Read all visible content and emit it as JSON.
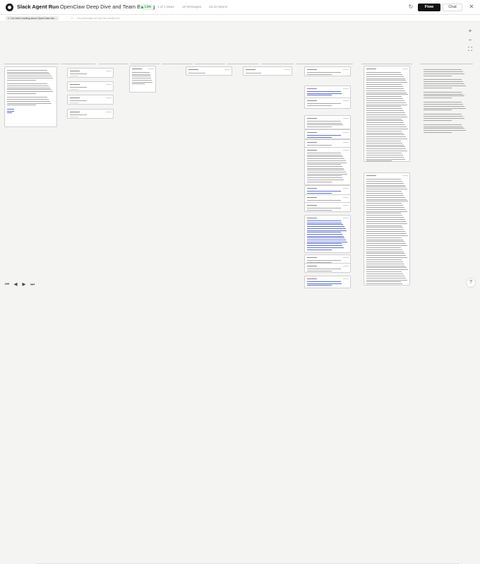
{
  "app": {
    "title": "Slack Agent Run",
    "separator": "—",
    "run_title": "OpenClaw Deep Dive and Team Briefing",
    "live_label": "Live"
  },
  "meta": {
    "steps": "1 of 1 steps",
    "messages": "18 Messages",
    "tokens": "16.1k tokens"
  },
  "toolbar": {
    "refresh_icon": "↻",
    "flow_label": "Flow",
    "chat_label": "Chat",
    "close_icon": "✕",
    "flow_icon": "▦",
    "chat_icon": "☐"
  },
  "steps": [
    {
      "label": "1. I've been reading about OpenClaw lots..."
    },
    {
      "label": "2. ... I'm personally not sure the results of it."
    }
  ],
  "zoom": {
    "in": "+",
    "out": "−",
    "fit": "⛶"
  },
  "playback": {
    "first": "⏮",
    "prev": "◀",
    "next": "▶",
    "last": "⏭",
    "help": "?"
  },
  "colors": {
    "live_green": "#22a35a",
    "link_blue": "#5d6fd9",
    "accent_dark": "#111111"
  }
}
